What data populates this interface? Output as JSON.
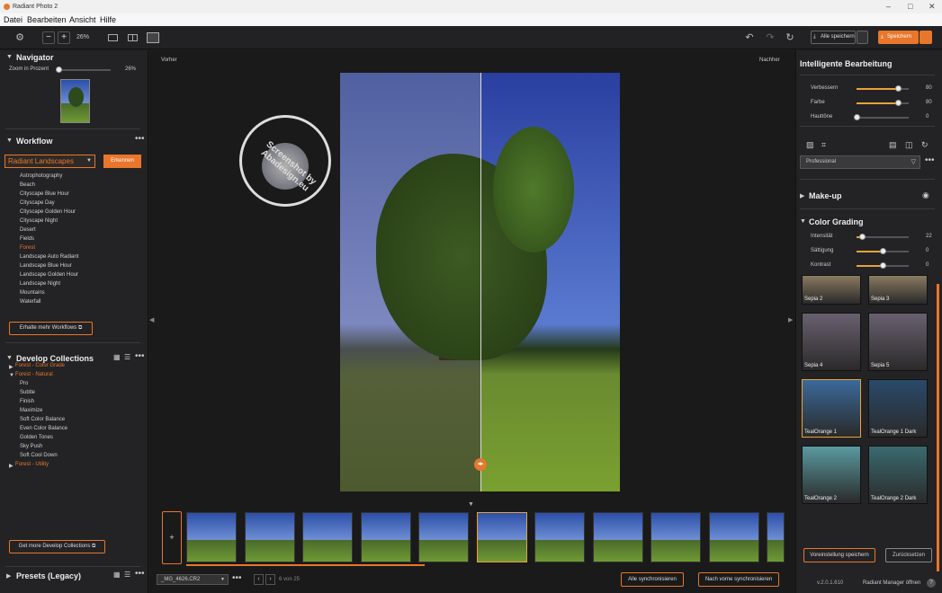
{
  "app": {
    "title": "Radiant Photo 2"
  },
  "menu": [
    "Datei",
    "Bearbeiten",
    "Ansicht",
    "Hilfe"
  ],
  "toolbar": {
    "zoom": "26%",
    "save_all": "Alle speichern",
    "save": "Speichern"
  },
  "navigator": {
    "title": "Navigator",
    "zoom_label": "Zoom in Prozent",
    "zoom_value": "26%",
    "zoom_fraction": 0.0
  },
  "workflow": {
    "title": "Workflow",
    "selected": "Radiant Landscapes",
    "detect": "Erkennen",
    "items": [
      "Astrophotography",
      "Beach",
      "Cityscape Blue Hour",
      "Cityscape Day",
      "Cityscape Golden Hour",
      "Cityscape Night",
      "Desert",
      "Fields",
      "Forest",
      "Landscape Auto Radiant",
      "Landscape Blue Hour",
      "Landscape Golden Hour",
      "Landscape Night",
      "Mountains",
      "Waterfall"
    ],
    "active": "Forest",
    "more": "Erhalte mehr Workflows"
  },
  "collections": {
    "title": "Develop Collections",
    "groups": [
      {
        "label": "Forest - Color Grade",
        "open": false
      },
      {
        "label": "Forest - Natural",
        "open": true
      }
    ],
    "items": [
      "Pro",
      "Subtle",
      "Finish",
      "Maximize",
      "Soft Color Balance",
      "Even Color Balance",
      "Golden Tones",
      "Sky Push",
      "Soft Cool Down"
    ],
    "group3": "Forest - Utility",
    "more": "Get more Develop Collections"
  },
  "presets": {
    "title": "Presets (Legacy)"
  },
  "viewer": {
    "before": "Vorher",
    "after": "Nachher",
    "watermark": "Screenshot by Abadesign.eu"
  },
  "bottom": {
    "file": "_MG_4626.CR2",
    "count": "6 von 25",
    "sync_all": "Alle synchronisieren",
    "sync_forward": "Nach vorne synchronisieren",
    "add": "+"
  },
  "right": {
    "title": "Intelligente Bearbeitung",
    "sliders": [
      {
        "label": "Verbessern",
        "value": "80",
        "frac": 0.8
      },
      {
        "label": "Farbe",
        "value": "80",
        "frac": 0.8
      },
      {
        "label": "Hauttöne",
        "value": "0",
        "frac": 0.0
      }
    ],
    "profile": "Professional",
    "makeup": "Make-up",
    "grading": "Color Grading",
    "grading_sliders": [
      {
        "label": "Intensität",
        "value": "22",
        "frac": 0.11
      },
      {
        "label": "Sättigung",
        "value": "0",
        "frac": 0.5
      },
      {
        "label": "Kontrast",
        "value": "0",
        "frac": 0.5
      }
    ],
    "thumbs": [
      {
        "label": "Sepia 2"
      },
      {
        "label": "Sepia 3"
      },
      {
        "label": "Sepia 4"
      },
      {
        "label": "Sepia 5"
      },
      {
        "label": "TealOrange 1"
      },
      {
        "label": "TealOrange 1 Dark"
      },
      {
        "label": "TealOrange 2"
      },
      {
        "label": "TealOrange 2 Dark"
      }
    ],
    "save_preset": "Voreinstellung speichern",
    "reset": "Zurücksetzen",
    "version": "v.2.0.1.610",
    "manager": "Radiant Manager öffnen"
  }
}
